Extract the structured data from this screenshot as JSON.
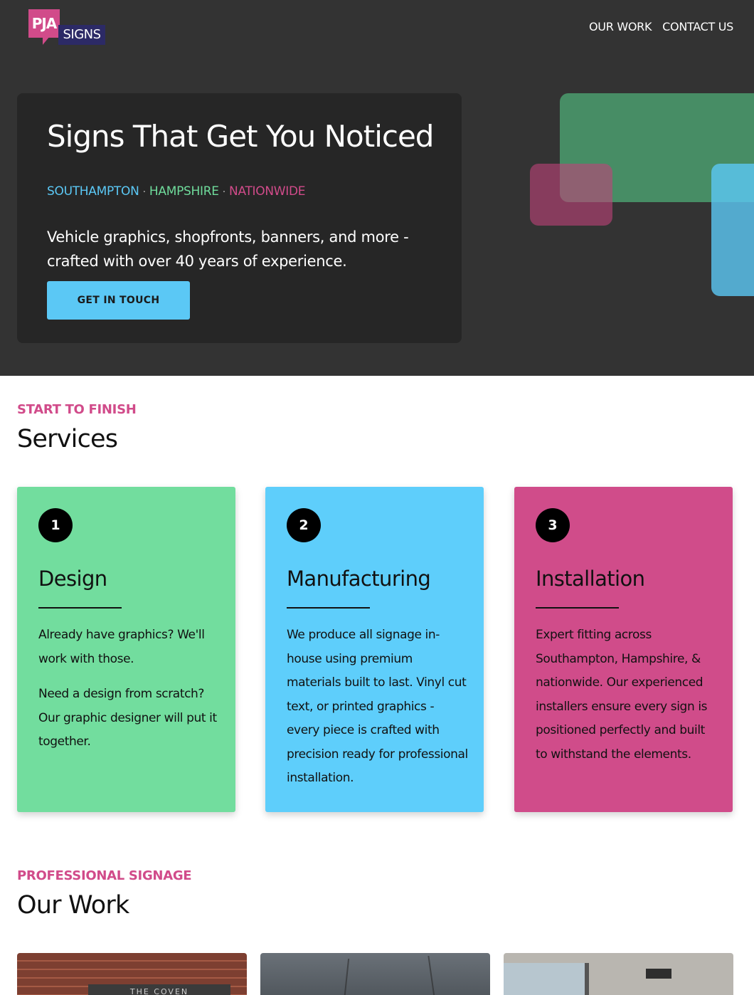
{
  "header": {
    "logo": {
      "top": "PJA",
      "bottom": "SIGNS"
    },
    "nav": [
      {
        "label": "OUR WORK"
      },
      {
        "label": "CONTACT US"
      }
    ]
  },
  "hero": {
    "title": "Signs That Get You Noticed",
    "locations": [
      "SOUTHAMPTON",
      "HAMPSHIRE",
      "NATIONWIDE"
    ],
    "separator": "·",
    "description": "Vehicle graphics, shopfronts, banners, and more - crafted with over 40 years of experience.",
    "cta_label": "GET IN TOUCH"
  },
  "services": {
    "eyebrow": "START TO FINISH",
    "title": "Services",
    "cards": [
      {
        "number": "1",
        "title": "Design",
        "paragraphs": [
          "Already have graphics? We'll work with those.",
          "Need a design from scratch? Our graphic designer will put it together."
        ]
      },
      {
        "number": "2",
        "title": "Manufacturing",
        "paragraphs": [
          "We produce all signage in-house using premium materials built to last. Vinyl cut text, or printed graphics - every piece is crafted with precision ready for professional installation."
        ]
      },
      {
        "number": "3",
        "title": "Installation",
        "paragraphs": [
          "Expert fitting across Southampton, Hampshire, & nationwide. Our experienced installers ensure every sign is positioned perfectly and built to withstand the elements."
        ]
      }
    ]
  },
  "work": {
    "eyebrow": "PROFESSIONAL SIGNAGE",
    "title": "Our Work",
    "thumb1_sign": "THE COVEN"
  },
  "colors": {
    "header_bg": "#333333",
    "accent_blue": "#5bc8f5",
    "accent_green": "#72dd9e",
    "accent_pink": "#d04c8a",
    "logo_navy": "#2c2a66"
  }
}
